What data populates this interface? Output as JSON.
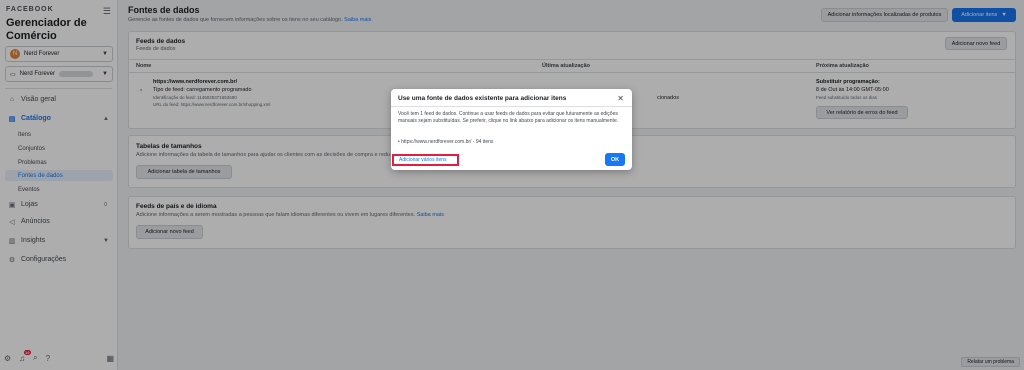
{
  "sidebar": {
    "brand": "FACEBOOK",
    "app_title": "Gerenciador de Comércio",
    "account1": {
      "initial": "N",
      "name": "Nerd Forever"
    },
    "account2": {
      "name": "Nerd Forever"
    },
    "nav": {
      "visao_geral": "Visão geral",
      "catalogo": "Catálogo",
      "catalogo_sub": [
        "Itens",
        "Conjuntos",
        "Problemas",
        "Fontes de dados",
        "Eventos"
      ],
      "lojas": "Lojas",
      "lojas_count": "0",
      "anuncios": "Anúncios",
      "insights": "Insights",
      "configuracoes": "Configurações"
    },
    "notif_count": "10"
  },
  "main": {
    "title": "Fontes de dados",
    "subtitle": "Gerencie as fontes de dados que fornecem informações sobre os itens no seu catálogo.",
    "subtitle_link": "Saiba mais",
    "btn_add_local": "Adicionar informações localizadas de produtos",
    "btn_add_items": "Adicionar itens",
    "feeds_card": {
      "title": "Feeds de dados",
      "sub": "Feeds de dados",
      "btn_add_feed": "Adicionar novo feed",
      "col_name": "Nome",
      "col_last": "Última atualização",
      "col_next": "Próxima atualização",
      "feed_url": "https://www.nerdforever.com.br/",
      "feed_type": "Tipo de feed: carregamento programado",
      "feed_id": "Identificação do feed: 1146025371652690",
      "feed_src": "URL do feed: https://www.nerdforever.com.br/shopping.xml",
      "last_partial": "cionados",
      "next_title": "Substituir programação:",
      "next_date": "8 de Out às 14:00 GMT-05:00",
      "next_note": "Feed substituído todos os dias",
      "btn_errors": "Ver relatório de erros do feed"
    },
    "sizes_card": {
      "title": "Tabelas de tamanhos",
      "sub": "Adicione informações da tabela de tamanhos para ajudar os clientes com as decisões de compra e redu",
      "btn": "Adicionar tabela de tamanhos"
    },
    "country_card": {
      "title": "Feeds de país e de idioma",
      "sub": "Adicione informações a serem mostradas a pessoas que falam idiomas diferentes ou vivem em lugares diferentes.",
      "sub_link": "Saiba mais",
      "btn": "Adicionar novo feed"
    },
    "report_problem": "Relatar um problema"
  },
  "modal": {
    "title": "Use uma fonte de dados existente para adicionar itens",
    "body": "Você tem 1 feed de dados. Continue a usar feeds de dados para evitar que futuramente as edições manuais sejam substituídas. Se preferir, clique no link abaixo para adicionar os itens manualmente.",
    "list_item": "• https://www.nerdforever.com.br/ · 94 itens",
    "link": "Adicionar vários itens",
    "ok": "OK"
  }
}
